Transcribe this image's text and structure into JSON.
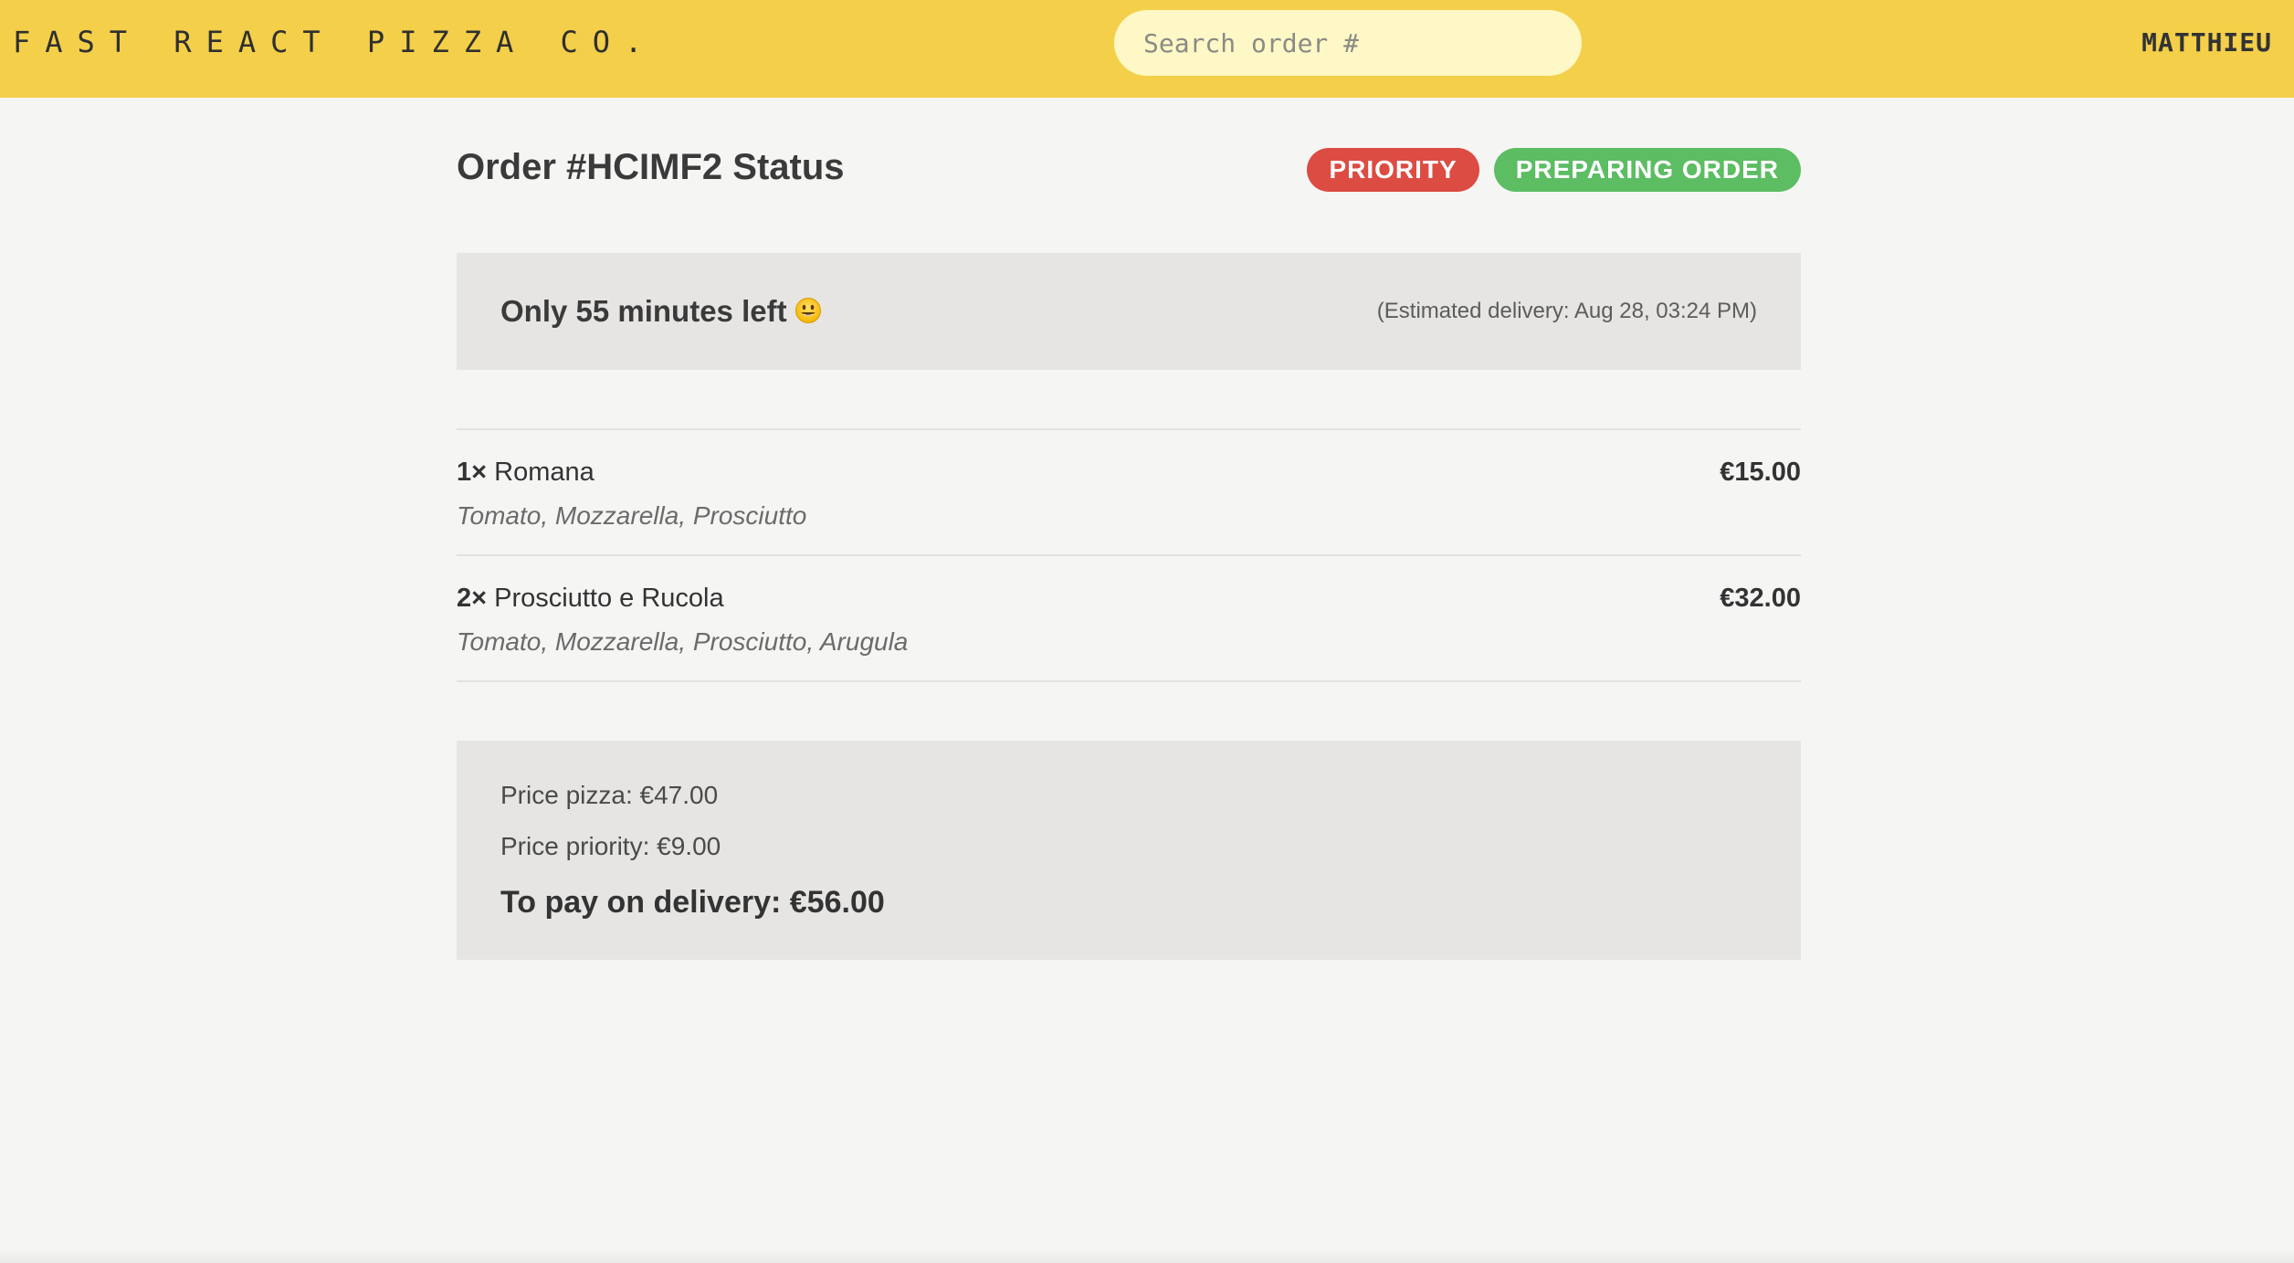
{
  "header": {
    "logo": "FAST REACT PIZZA CO.",
    "search_placeholder": "Search order #",
    "username": "MATTHIEU",
    "background": "#f3cf4a"
  },
  "order": {
    "title": "Order #HCIMF2 Status",
    "badges": {
      "priority": "PRIORITY",
      "status": "PREPARING ORDER"
    },
    "eta": {
      "time_left": "Only 55 minutes left",
      "emoji_icon": "smiley-face-icon",
      "estimated_delivery": "(Estimated delivery: Aug 28, 03:24 PM)"
    },
    "items": [
      {
        "qty": "1×",
        "name": "Romana",
        "price": "€15.00",
        "ingredients": "Tomato, Mozzarella, Prosciutto"
      },
      {
        "qty": "2×",
        "name": "Prosciutto e Rucola",
        "price": "€32.00",
        "ingredients": "Tomato, Mozzarella, Prosciutto, Arugula"
      }
    ],
    "totals": {
      "price_pizza": "Price pizza: €47.00",
      "price_priority": "Price priority: €9.00",
      "to_pay": "To pay on delivery: €56.00"
    }
  },
  "colors": {
    "priority_badge": "#dc4c43",
    "status_badge": "#5cbd63",
    "panel_background": "#e6e5e3"
  }
}
